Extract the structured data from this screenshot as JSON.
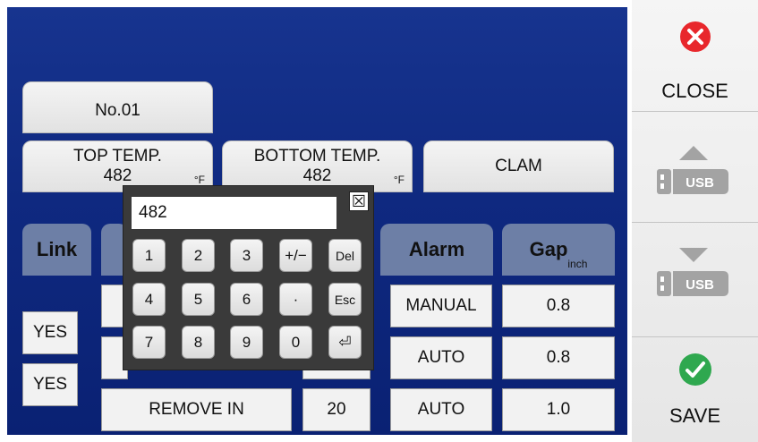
{
  "program": {
    "label": "No.01"
  },
  "top_temp": {
    "label": "TOP TEMP.",
    "value": "482",
    "unit": "°F"
  },
  "bottom_temp": {
    "label": "BOTTOM TEMP.",
    "value": "482",
    "unit": "°F"
  },
  "clam": {
    "label": "CLAM"
  },
  "headers": {
    "link": "Link",
    "alarm": "Alarm",
    "gap": "Gap",
    "gap_unit": "inch"
  },
  "rows": [
    {
      "link": "",
      "step": "",
      "time": "",
      "alarm": "MANUAL",
      "gap": "0.8"
    },
    {
      "link": "YES",
      "step": "",
      "time": "",
      "alarm": "AUTO",
      "gap": "0.8"
    },
    {
      "link": "YES",
      "step": "REMOVE IN",
      "time": "20",
      "alarm": "AUTO",
      "gap": "1.0"
    }
  ],
  "keypad": {
    "display_value": "482",
    "close_symbol": "☒",
    "keys": [
      "1",
      "2",
      "3",
      "+/−",
      "Del",
      "4",
      "5",
      "6",
      "·",
      "Esc",
      "7",
      "8",
      "9",
      "0",
      "⏎"
    ]
  },
  "sidebar": {
    "close_label": "CLOSE",
    "usb_label": "USB",
    "save_label": "SAVE"
  },
  "colors": {
    "screen_bg": "#0f2980",
    "header_bg": "#6d7fa6",
    "close_red": "#e8272c",
    "save_green": "#2fa84f"
  },
  "icons": [
    "close-icon",
    "usb-upload-icon",
    "usb-download-icon",
    "checkmark-icon"
  ]
}
